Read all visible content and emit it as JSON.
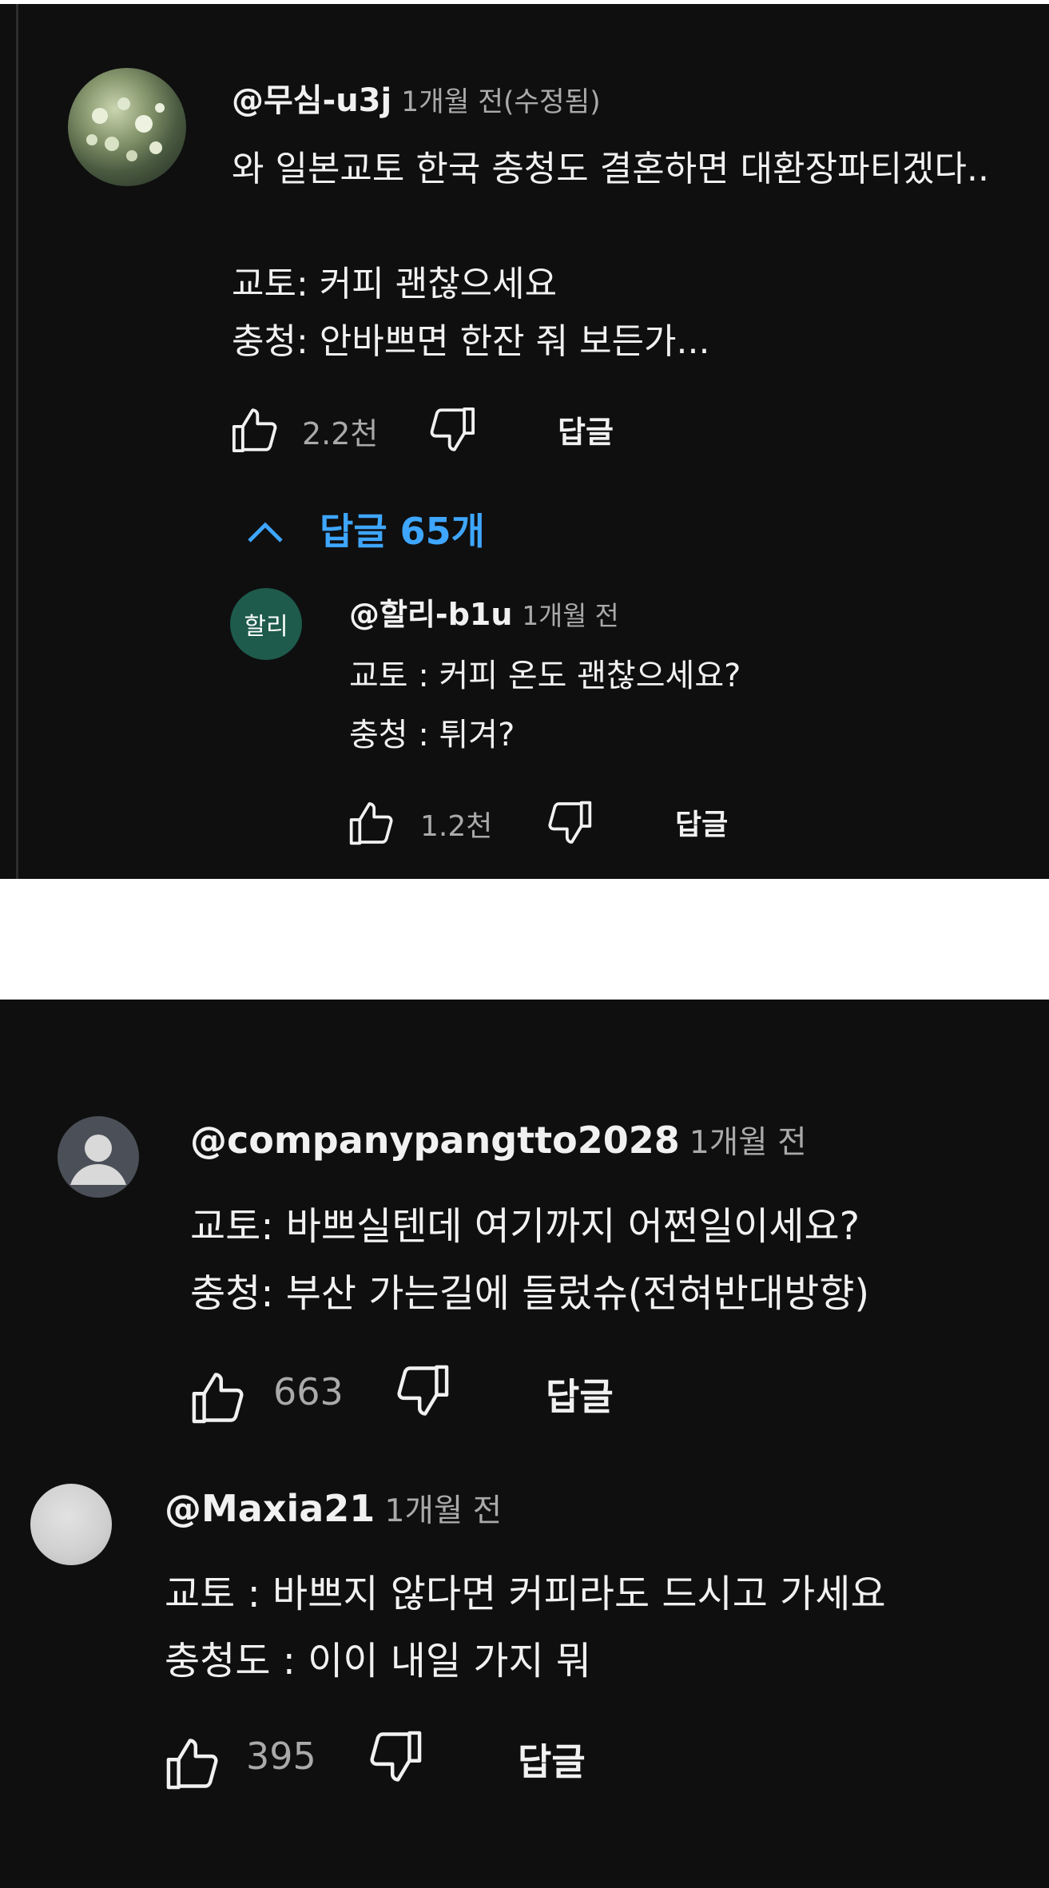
{
  "colors": {
    "background": "#0f0f0f",
    "text": "#f1f1f1",
    "secondary": "#aaaaaa",
    "link": "#3ea6ff",
    "reply_avatar": "#1e5b4c"
  },
  "icons": {
    "like": "thumbs-up-icon",
    "dislike": "thumbs-down-icon",
    "collapse": "chevron-up-icon"
  },
  "comment1": {
    "handle": "@무심-u3j",
    "time": "1개월 전(수정됨)",
    "lines": [
      "와 일본교토 한국 충청도 결혼하면 대환장파티겠다..",
      "",
      "교토: 커피 괜찮으세요",
      "충청: 안바쁘면 한잔 줘 보든가..."
    ],
    "likes": "2.2천",
    "reply_label": "답글",
    "replies_toggle": "답글 65개",
    "reply": {
      "avatar_text": "할리",
      "handle": "@할리-b1u",
      "time": "1개월 전",
      "lines": [
        "교토 : 커피 온도 괜찮으세요?",
        "충청 : 튀겨?"
      ],
      "likes": "1.2천",
      "reply_label": "답글"
    }
  },
  "comment2": {
    "handle": "@companypangtto2028",
    "time": "1개월 전",
    "lines": [
      "교토: 바쁘실텐데 여기까지 어쩐일이세요?",
      "충청: 부산 가는길에 들렀슈(전혀반대방향)"
    ],
    "likes": "663",
    "reply_label": "답글"
  },
  "comment3": {
    "handle": "@Maxia21",
    "time": "1개월 전",
    "lines": [
      "교토 : 바쁘지 않다면 커피라도 드시고 가세요",
      "충청도 : 이이 내일 가지 뭐"
    ],
    "likes": "395",
    "reply_label": "답글"
  }
}
